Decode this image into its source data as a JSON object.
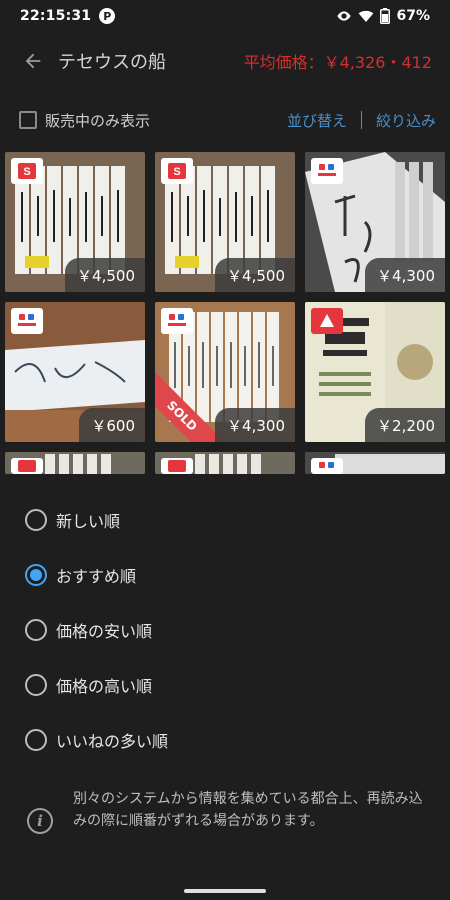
{
  "status_bar": {
    "time": "22:15:31",
    "notification_icon": "P",
    "battery": "67%",
    "icons": [
      "eye-icon",
      "wifi-icon",
      "battery-icon"
    ]
  },
  "app_bar": {
    "back_icon": "arrow-left-icon",
    "title": "テセウスの船",
    "average_price": "平均価格：￥4,326・412"
  },
  "filter_bar": {
    "on_sale_only_label": "販売中のみ表示",
    "on_sale_only_checked": false,
    "sort_label": "並び替え",
    "filter_label": "絞り込み"
  },
  "listings": [
    {
      "price": "￥4,500",
      "badge": "mercari-logo",
      "sold": false
    },
    {
      "price": "￥4,500",
      "badge": "mercari-logo",
      "sold": false
    },
    {
      "price": "￥4,300",
      "badge": "rakuma-logo",
      "sold": false
    },
    {
      "price": "￥600",
      "badge": "rakuma-logo",
      "sold": false
    },
    {
      "price": "￥4,300",
      "badge": "rakuma-logo",
      "sold": true,
      "sold_label": "SOLD"
    },
    {
      "price": "￥2,200",
      "badge": "paypay-flea-logo",
      "sold": false
    }
  ],
  "sort_sheet": {
    "options": [
      {
        "label": "新しい順",
        "selected": false
      },
      {
        "label": "おすすめ順",
        "selected": true
      },
      {
        "label": "価格の安い順",
        "selected": false
      },
      {
        "label": "価格の高い順",
        "selected": false
      },
      {
        "label": "いいねの多い順",
        "selected": false
      }
    ],
    "note_icon": "info-icon",
    "note": "別々のシステムから情報を集めている都合上、再読み込みの際に順番がずれる場合があります。"
  },
  "colors": {
    "background": "#1e1e1e",
    "accent_blue": "#42a5f5",
    "link_blue": "#4a8ec9",
    "price_red": "#d32f2f",
    "sold_red": "#e0474d"
  }
}
